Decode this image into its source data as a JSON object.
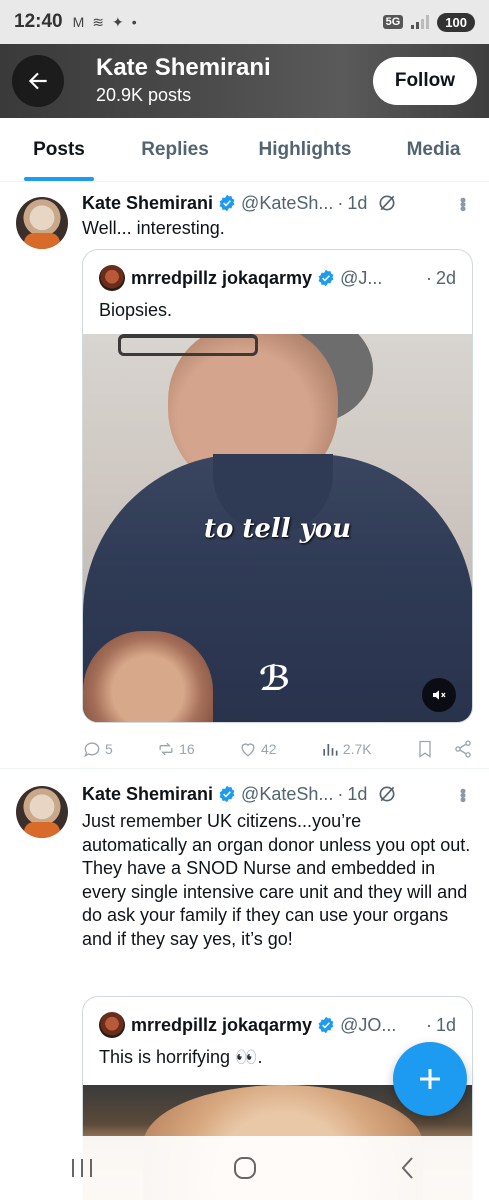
{
  "status_bar": {
    "time": "12:40",
    "network": "5G",
    "battery": "100"
  },
  "header": {
    "name": "Kate Shemirani",
    "posts_count": "20.9K posts",
    "follow_label": "Follow"
  },
  "tabs": [
    {
      "label": "Posts",
      "active": true
    },
    {
      "label": "Replies",
      "active": false
    },
    {
      "label": "Highlights",
      "active": false
    },
    {
      "label": "Media",
      "active": false
    }
  ],
  "posts": [
    {
      "author": "Kate Shemirani",
      "handle": "@KateSh...",
      "time": "1d",
      "text": "Well... interesting.",
      "quote": {
        "author": "mrredpillz jokaqarmy",
        "handle": "@J...",
        "time": "2d",
        "text": "Biopsies.",
        "video_caption": "to tell you"
      },
      "stats": {
        "replies": "5",
        "reposts": "16",
        "likes": "42",
        "views": "2.7K"
      }
    },
    {
      "author": "Kate Shemirani",
      "handle": "@KateSh...",
      "time": "1d",
      "text": "Just remember UK citizens...you’re automatically an organ donor unless you opt out. They have a SNOD  Nurse and embedded in every single intensive care unit and they will and do ask your family if they can use your organs and if they say yes, it’s go!",
      "quote": {
        "author": "mrredpillz jokaqarmy",
        "handle": "@JO...",
        "time": "1d",
        "text": "This is horrifying 👀."
      }
    }
  ],
  "colors": {
    "accent": "#1d9bf0",
    "text": "#0f1419",
    "muted": "#536471"
  }
}
